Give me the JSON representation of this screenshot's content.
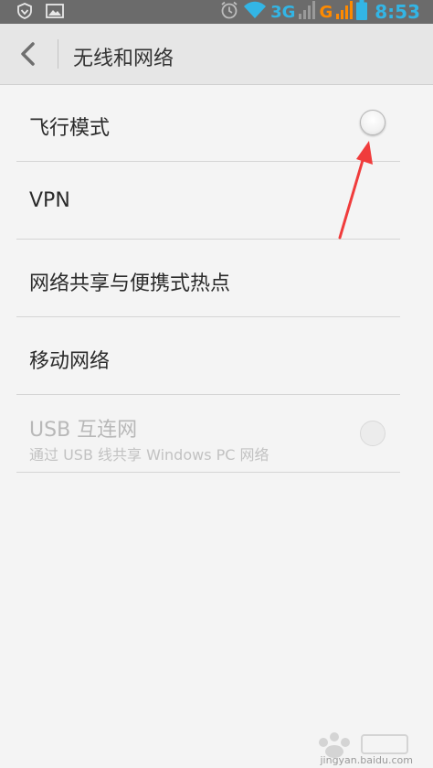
{
  "status_bar": {
    "network_3g": "3G",
    "network_g": "G",
    "time": "8:53",
    "icons": [
      "shield-icon",
      "image-icon",
      "alarm-icon",
      "wifi-icon",
      "signal-icon",
      "signal-icon",
      "battery-icon"
    ]
  },
  "header": {
    "title": "无线和网络",
    "back_icon": "chevron-left-icon"
  },
  "settings": {
    "items": [
      {
        "title": "飞行模式",
        "control": "radio",
        "checked": false,
        "enabled": true
      },
      {
        "title": "VPN"
      },
      {
        "title": "网络共享与便携式热点"
      },
      {
        "title": "移动网络"
      },
      {
        "title": "USB 互连网",
        "subtitle": "通过 USB 线共享 Windows PC 网络",
        "control": "radio",
        "checked": false,
        "enabled": false
      }
    ]
  },
  "watermark": {
    "text": "jingyan.baidu.com"
  },
  "colors": {
    "accent_blue": "#33b5e5",
    "accent_orange": "#ff8a00",
    "annotation_red": "#f03c3c",
    "status_bar_bg": "#6b6b6b",
    "action_bar_bg": "#e6e6e6",
    "page_bg": "#f4f4f4"
  }
}
